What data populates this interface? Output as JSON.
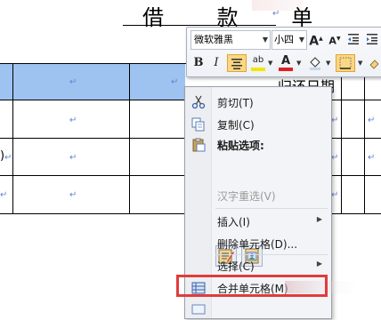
{
  "document": {
    "title": "借 款 单",
    "paragraph_mark": "↵",
    "header_cell_date": "归还日期",
    "row3_left_fragment": ")"
  },
  "mini_toolbar": {
    "font_name": "微软雅黑",
    "font_size": "小四",
    "grow_font": "A",
    "shrink_font": "A",
    "bold": "B",
    "italic": "I",
    "highlight_label": "ab",
    "font_color_label": "A"
  },
  "context_menu": {
    "items": [
      {
        "label": "剪切(T)",
        "icon": "scissors-icon",
        "enabled": true
      },
      {
        "label": "复制(C)",
        "icon": "copy-icon",
        "enabled": true
      },
      {
        "label": "粘贴选项:",
        "icon": "paste-icon",
        "enabled": true
      },
      {
        "label": "汉字重选(V)",
        "icon": "",
        "enabled": false
      },
      {
        "label": "插入(I)",
        "icon": "",
        "enabled": true,
        "submenu": true
      },
      {
        "label": "删除单元格(D)...",
        "icon": "",
        "enabled": true
      },
      {
        "label": "选择(C)",
        "icon": "",
        "enabled": true,
        "submenu": true
      },
      {
        "label": "合并单元格(M)",
        "icon": "merge-cells-icon",
        "enabled": true,
        "highlighted": true
      }
    ]
  },
  "colors": {
    "selection": "#9ec3f0",
    "highlight_box": "#e03c3c",
    "menu_bg": "#f3f4f7"
  }
}
